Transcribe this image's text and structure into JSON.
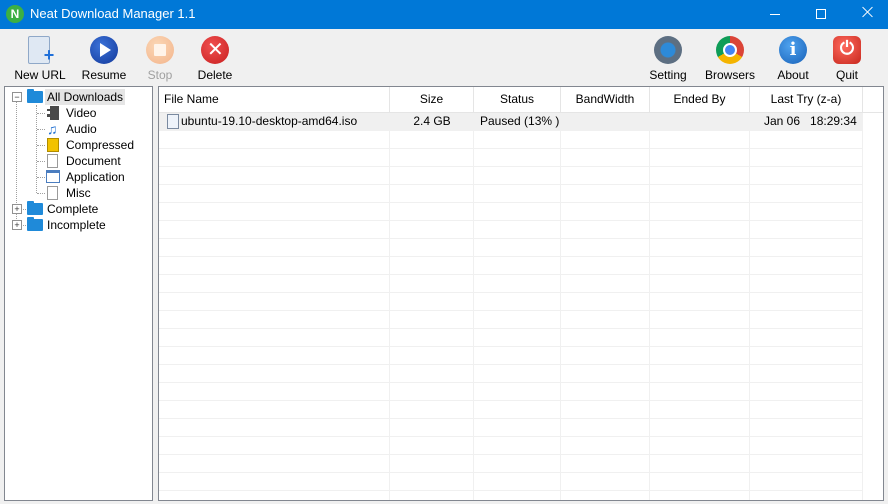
{
  "window": {
    "title": "Neat Download Manager 1.1",
    "logo": "N"
  },
  "toolbar": {
    "buttons": [
      {
        "label": "New URL",
        "icon": "new-url-icon",
        "enabled": true
      },
      {
        "label": "Resume",
        "icon": "resume-icon",
        "enabled": true
      },
      {
        "label": "Stop",
        "icon": "stop-icon",
        "enabled": false
      },
      {
        "label": "Delete",
        "icon": "delete-icon",
        "enabled": true
      },
      {
        "label": "Setting",
        "icon": "setting-icon",
        "enabled": true
      },
      {
        "label": "Browsers",
        "icon": "browsers-icon",
        "enabled": true
      },
      {
        "label": "About",
        "icon": "about-icon",
        "enabled": true
      },
      {
        "label": "Quit",
        "icon": "quit-icon",
        "enabled": true
      }
    ]
  },
  "tree": {
    "root": {
      "label": "All Downloads",
      "expanded": true,
      "selected": true
    },
    "children": [
      {
        "label": "Video",
        "icon": "film-icon"
      },
      {
        "label": "Audio",
        "icon": "music-note-icon"
      },
      {
        "label": "Compressed",
        "icon": "archive-icon"
      },
      {
        "label": "Document",
        "icon": "document-icon"
      },
      {
        "label": "Application",
        "icon": "application-icon"
      },
      {
        "label": "Misc",
        "icon": "misc-file-icon"
      }
    ],
    "others": [
      {
        "label": "Complete",
        "expanded": false
      },
      {
        "label": "Incomplete",
        "expanded": false
      }
    ]
  },
  "list": {
    "columns": [
      "File Name",
      "Size",
      "Status",
      "BandWidth",
      "Ended By",
      "Last Try (z-a)"
    ],
    "rows": [
      {
        "file_name": "ubuntu-19.10-desktop-amd64.iso",
        "size": "2.4 GB",
        "status": "Paused (13% )",
        "bandwidth": "",
        "ended_by": "",
        "last_try": "Jan 06   18:29:34"
      }
    ]
  },
  "colors": {
    "titlebar": "#0078d7",
    "folder": "#1f8ad9",
    "row_highlight": "#f0f0f0"
  }
}
